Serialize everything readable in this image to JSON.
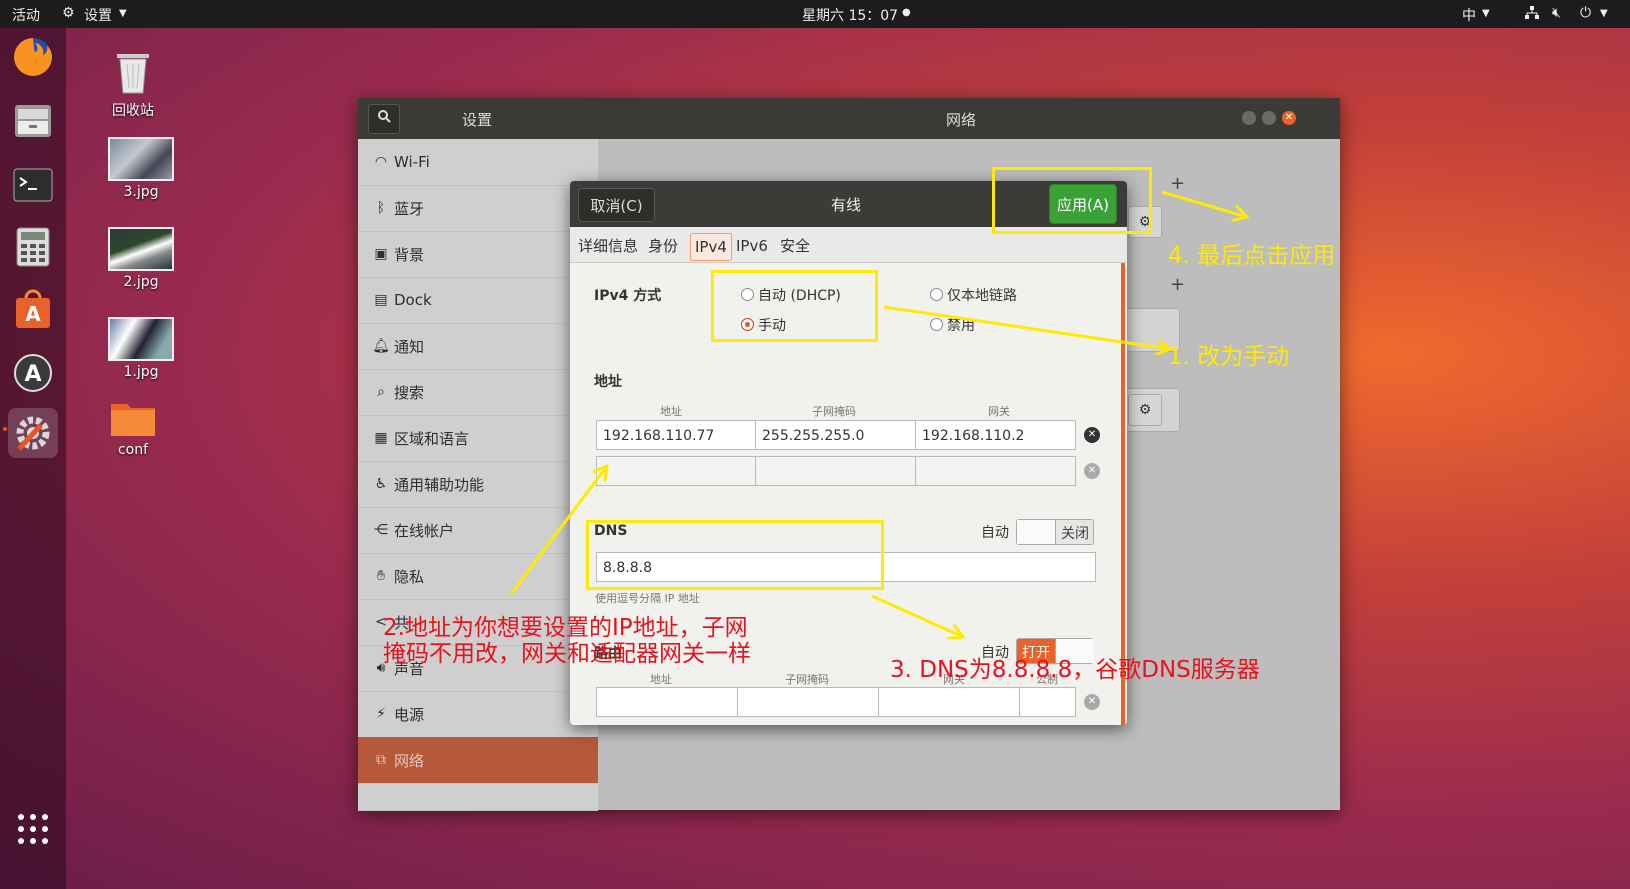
{
  "topbar": {
    "activities": "活动",
    "app_menu": "设置",
    "clock": "星期六 15：07",
    "input_method": "中"
  },
  "desktop": [
    {
      "label": "回收站"
    },
    {
      "label": "3.jpg"
    },
    {
      "label": "2.jpg"
    },
    {
      "label": "1.jpg"
    },
    {
      "label": "conf"
    }
  ],
  "settings": {
    "title": "设置",
    "panel_title": "网络",
    "sidebar": [
      {
        "label": "Wi-Fi",
        "icon": "wifi-icon"
      },
      {
        "label": "蓝牙",
        "icon": "bluetooth-icon"
      },
      {
        "label": "背景",
        "icon": "background-icon"
      },
      {
        "label": "Dock",
        "icon": "dock-icon"
      },
      {
        "label": "通知",
        "icon": "bell-icon"
      },
      {
        "label": "搜索",
        "icon": "search-icon"
      },
      {
        "label": "区域和语言",
        "icon": "region-icon"
      },
      {
        "label": "通用辅助功能",
        "icon": "accessibility-icon"
      },
      {
        "label": "在线帐户",
        "icon": "online-accounts-icon"
      },
      {
        "label": "隐私",
        "icon": "privacy-icon"
      },
      {
        "label": "共",
        "icon": "share-icon"
      },
      {
        "label": "声音",
        "icon": "sound-icon"
      },
      {
        "label": "电源",
        "icon": "power-icon"
      },
      {
        "label": "网络",
        "icon": "network-icon"
      }
    ]
  },
  "dialog": {
    "title": "有线",
    "cancel": "取消(C)",
    "apply": "应用(A)",
    "tabs": [
      "详细信息",
      "身份",
      "IPv4",
      "IPv6",
      "安全"
    ],
    "ipv4_method_label": "IPv4 方式",
    "method_options": {
      "auto": "自动 (DHCP)",
      "manual": "手动",
      "link_local": "仅本地链路",
      "disabled": "禁用"
    },
    "selected_method": "manual",
    "address_section": "地址",
    "col_address": "地址",
    "col_netmask": "子网掩码",
    "col_gateway": "网关",
    "address": "192.168.110.77",
    "netmask": "255.255.255.0",
    "gateway": "192.168.110.2",
    "dns_label": "DNS",
    "auto_label": "自动",
    "dns_toggle_text": "关闭",
    "dns_value": "8.8.8.8",
    "dns_hint": "使用逗号分隔 IP 地址",
    "routes_label": "路由",
    "routes_toggle_text": "打开",
    "col_metric": "公制"
  },
  "annotations": {
    "a1": "1. 改为手动",
    "a2_line1": "2.地址为你想要设置的IP地址，子网",
    "a2_line2": "掩码不用改，网关和适配器网关一样",
    "a3": "3. DNS为8.8.8.8，谷歌DNS服务器",
    "a4": "4. 最后点击应用",
    "colors": {
      "yellow": "#ffea00",
      "red": "#e8121d",
      "highlight": "#ffea00"
    }
  }
}
